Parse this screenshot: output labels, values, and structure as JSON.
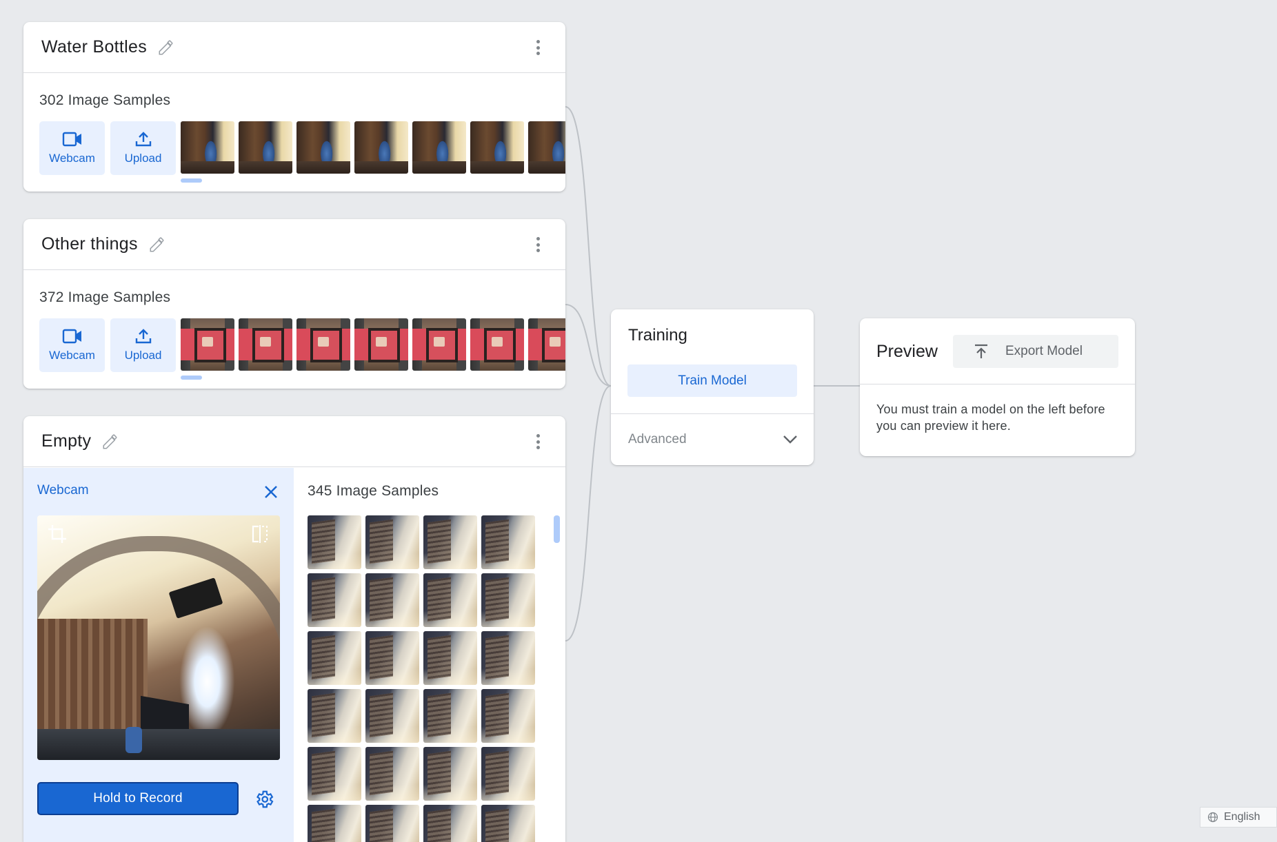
{
  "classes": [
    {
      "name": "Water Bottles",
      "samples_label": "302 Image Samples",
      "webcam_label": "Webcam",
      "upload_label": "Upload"
    },
    {
      "name": "Other things",
      "samples_label": "372 Image Samples",
      "webcam_label": "Webcam",
      "upload_label": "Upload"
    },
    {
      "name": "Empty",
      "samples_label": "345 Image Samples",
      "webcam_panel_title": "Webcam",
      "hold_to_record_label": "Hold to Record"
    }
  ],
  "training": {
    "title": "Training",
    "train_button_label": "Train Model",
    "advanced_label": "Advanced"
  },
  "preview": {
    "title": "Preview",
    "export_button_label": "Export Model",
    "message": "You must train a model on the left before you can preview it here."
  },
  "footer": {
    "language_label": "English"
  },
  "colors": {
    "background": "#e8eaed",
    "accent": "#1967d2",
    "accent_light": "#e8f0fe"
  },
  "icons": [
    "edit-icon",
    "more-vert-icon",
    "videocam-icon",
    "upload-icon",
    "close-icon",
    "crop-icon",
    "mirror-icon",
    "settings-icon",
    "chevron-down-icon",
    "export-icon",
    "globe-icon"
  ]
}
